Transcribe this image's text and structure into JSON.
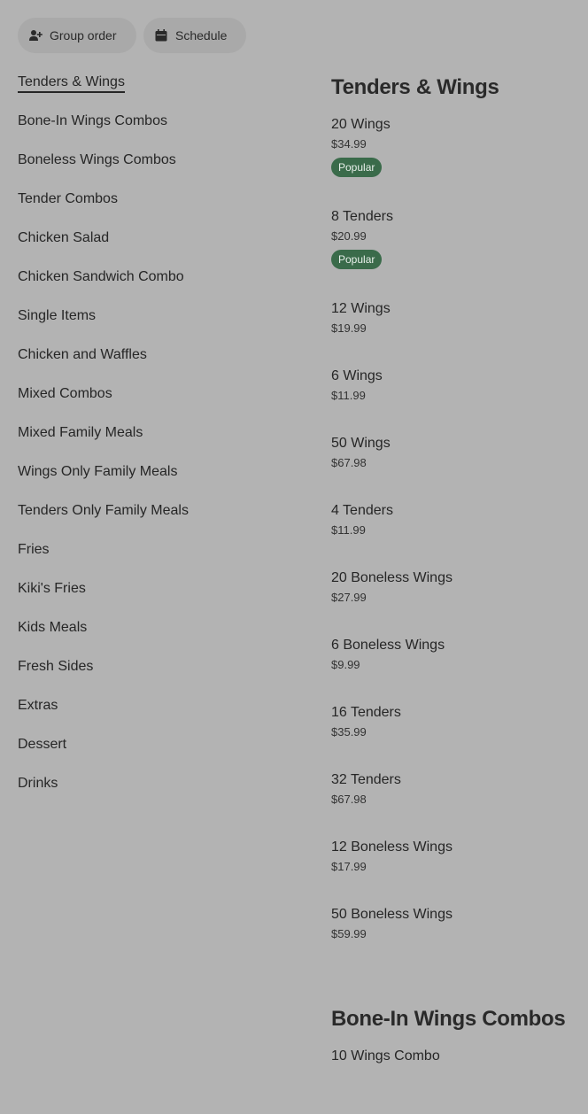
{
  "topbar": {
    "group_order": "Group order",
    "schedule": "Schedule"
  },
  "nav": {
    "items": [
      "Tenders & Wings",
      "Bone-In Wings Combos",
      "Boneless Wings Combos",
      "Tender Combos",
      "Chicken Salad",
      "Chicken Sandwich Combo",
      "Single Items",
      "Chicken and Waffles",
      "Mixed Combos",
      "Mixed Family Meals",
      "Wings Only Family Meals",
      "Tenders Only Family Meals",
      "Fries",
      "Kiki's Fries",
      "Kids Meals",
      "Fresh Sides",
      "Extras",
      "Dessert",
      "Drinks"
    ],
    "active": "Tenders & Wings"
  },
  "menu": {
    "section1": {
      "title": "Tenders & Wings",
      "products": [
        {
          "name": "20 Wings",
          "price": "$34.99",
          "badge": "Popular"
        },
        {
          "name": "8 Tenders",
          "price": "$20.99",
          "badge": "Popular"
        },
        {
          "name": "12 Wings",
          "price": "$19.99"
        },
        {
          "name": "6 Wings",
          "price": "$11.99"
        },
        {
          "name": "50 Wings",
          "price": "$67.98"
        },
        {
          "name": "4 Tenders",
          "price": "$11.99"
        },
        {
          "name": "20 Boneless Wings",
          "price": "$27.99"
        },
        {
          "name": "6 Boneless Wings",
          "price": "$9.99"
        },
        {
          "name": "16 Tenders",
          "price": "$35.99"
        },
        {
          "name": "32 Tenders",
          "price": "$67.98"
        },
        {
          "name": "12 Boneless Wings",
          "price": "$17.99"
        },
        {
          "name": "50 Boneless Wings",
          "price": "$59.99"
        }
      ]
    },
    "section2": {
      "title": "Bone-In Wings Combos",
      "products": [
        {
          "name": "10 Wings Combo"
        }
      ]
    }
  },
  "colors": {
    "background": "#b3b3b3",
    "badge": "#3a6b4a"
  },
  "icons": {
    "group_order": "add-person-icon",
    "schedule": "calendar-icon"
  }
}
